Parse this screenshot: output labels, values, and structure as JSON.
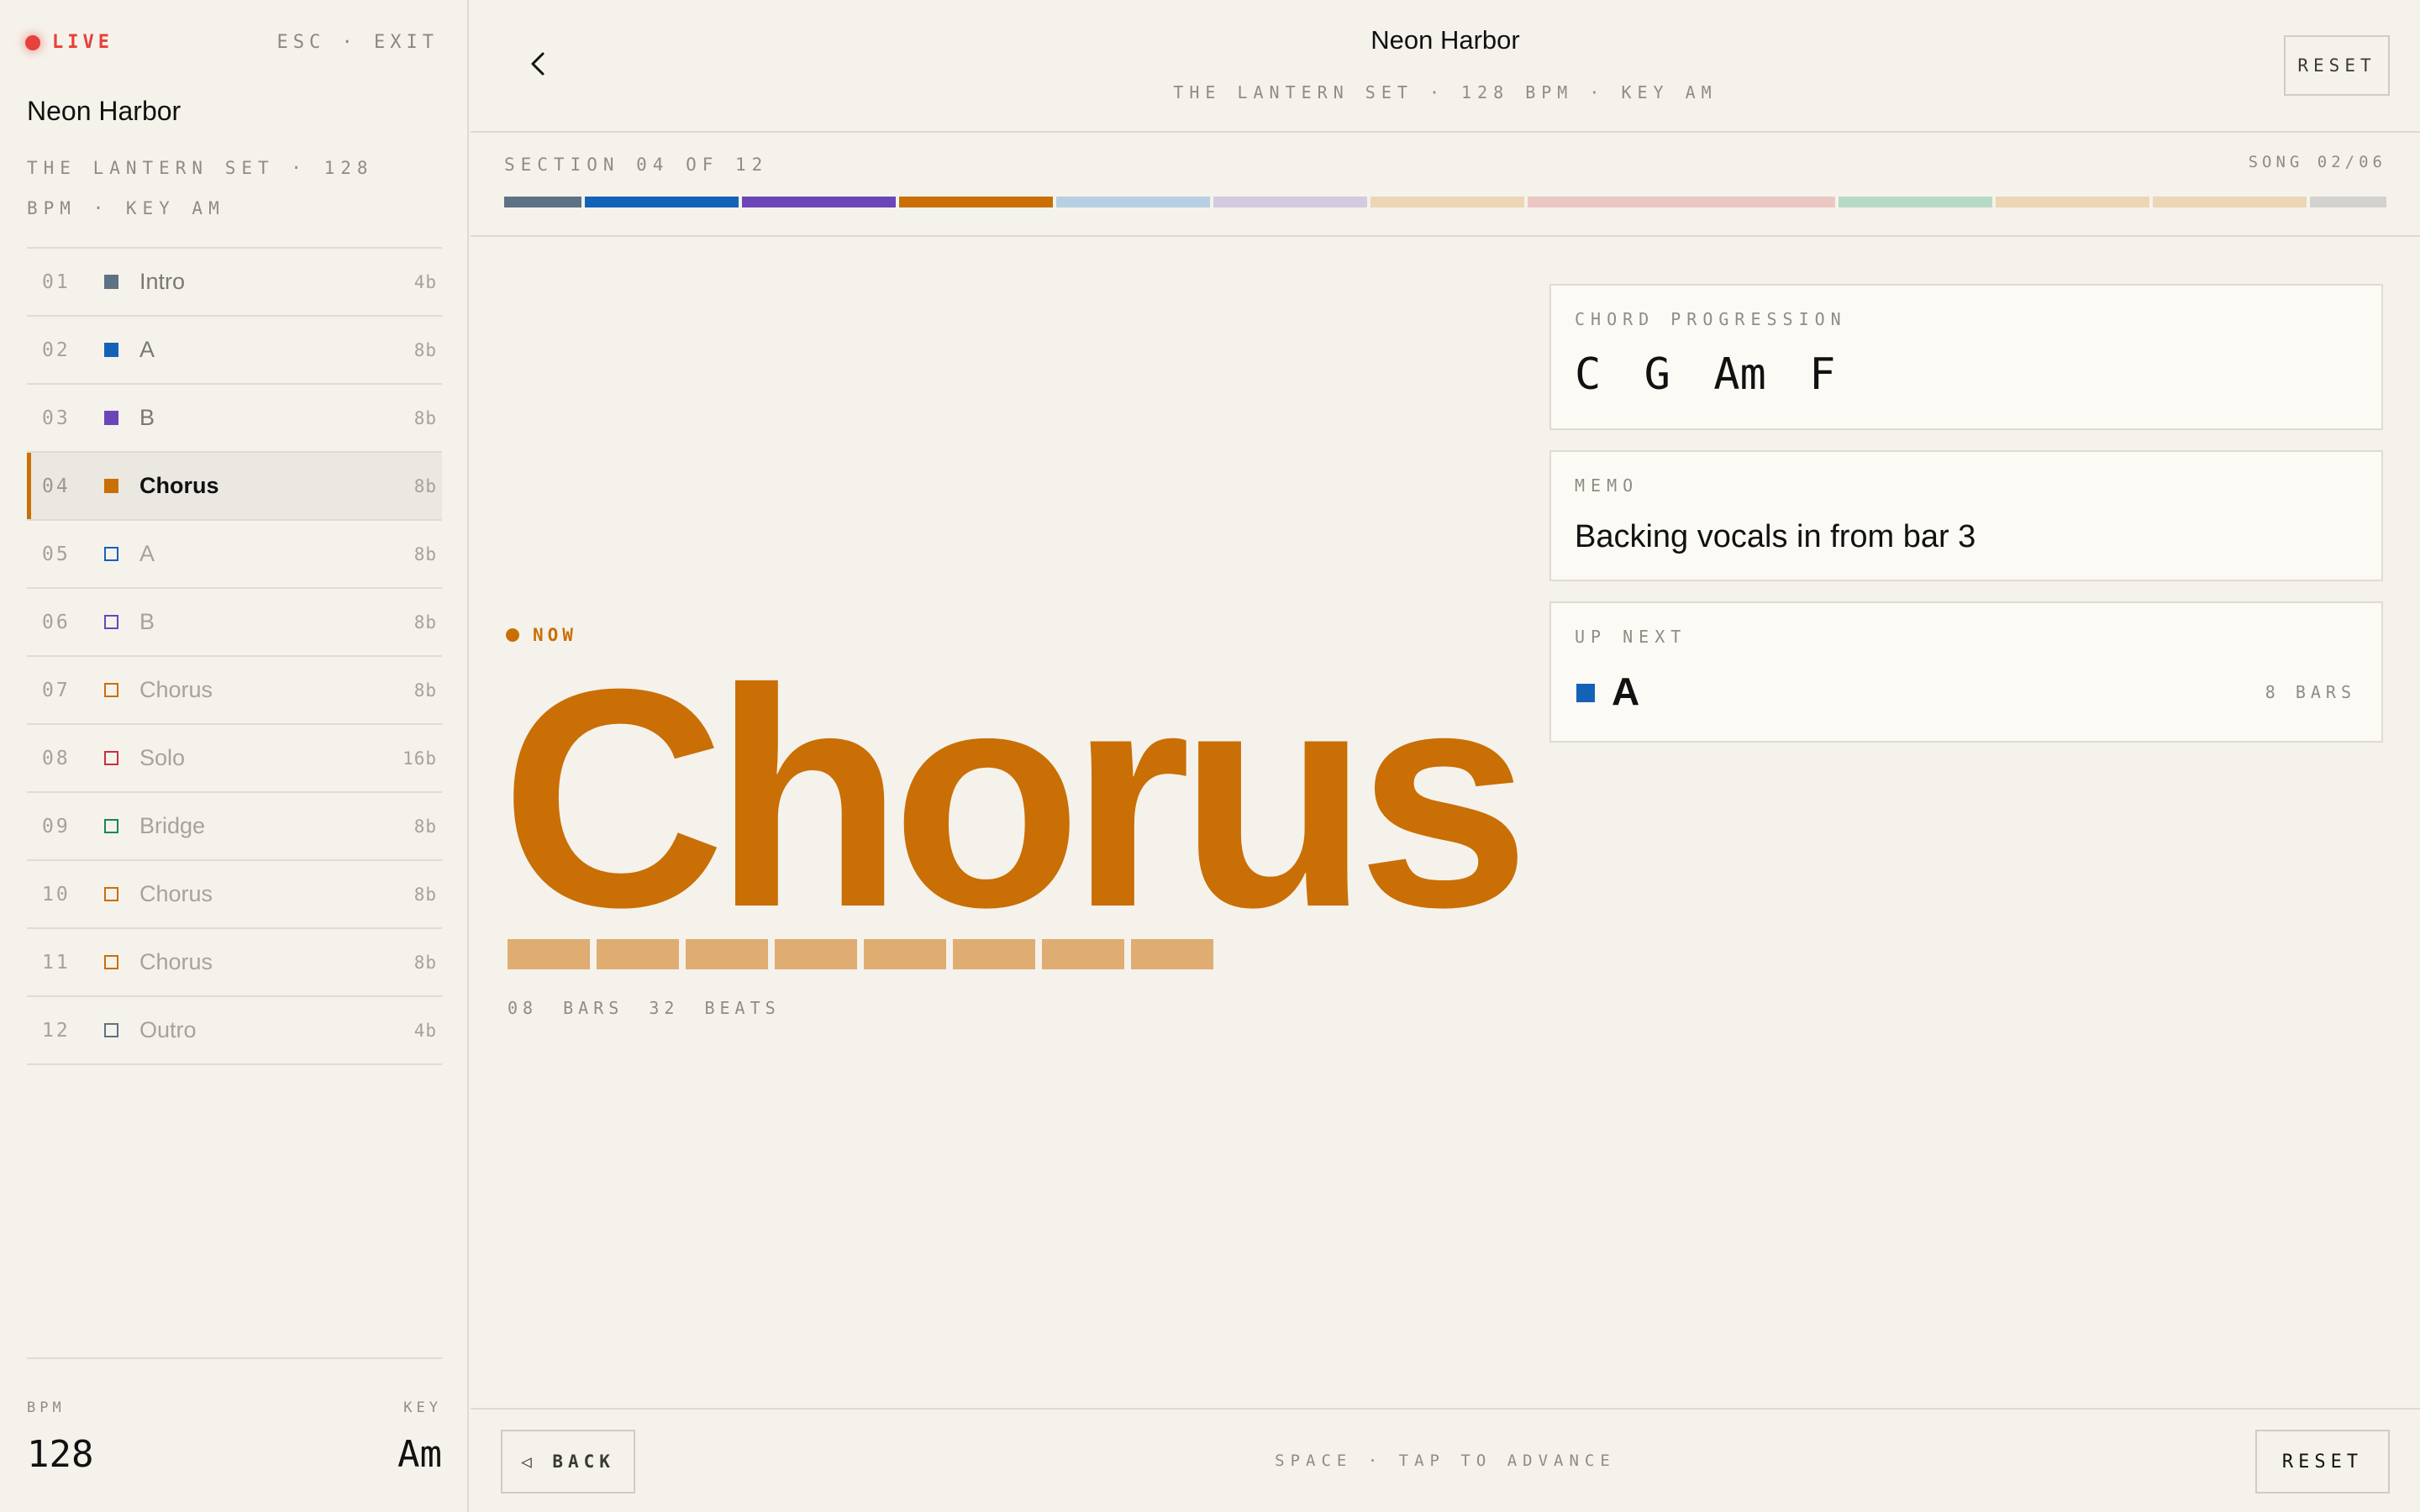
{
  "sidebar": {
    "live_label": "LIVE",
    "exit_label": "ESC · EXIT",
    "song_title": "Neon Harbor",
    "song_meta": "THE LANTERN SET · 128 BPM · KEY AM",
    "sections": [
      {
        "num": "01",
        "name": "Intro",
        "bars": "4b",
        "color": "#5e7185",
        "state": "played"
      },
      {
        "num": "02",
        "name": "A",
        "bars": "8b",
        "color": "#1462b8",
        "state": "played"
      },
      {
        "num": "03",
        "name": "B",
        "bars": "8b",
        "color": "#6b46b8",
        "state": "played"
      },
      {
        "num": "04",
        "name": "Chorus",
        "bars": "8b",
        "color": "#c96f06",
        "state": "active"
      },
      {
        "num": "05",
        "name": "A",
        "bars": "8b",
        "color": "#1462b8",
        "state": "upcoming"
      },
      {
        "num": "06",
        "name": "B",
        "bars": "8b",
        "color": "#6b46b8",
        "state": "upcoming"
      },
      {
        "num": "07",
        "name": "Chorus",
        "bars": "8b",
        "color": "#c96f06",
        "state": "upcoming"
      },
      {
        "num": "08",
        "name": "Solo",
        "bars": "16b",
        "color": "#c8313c",
        "state": "upcoming"
      },
      {
        "num": "09",
        "name": "Bridge",
        "bars": "8b",
        "color": "#14875a",
        "state": "upcoming"
      },
      {
        "num": "10",
        "name": "Chorus",
        "bars": "8b",
        "color": "#c96f06",
        "state": "upcoming"
      },
      {
        "num": "11",
        "name": "Chorus",
        "bars": "8b",
        "color": "#c96f06",
        "state": "upcoming"
      },
      {
        "num": "12",
        "name": "Outro",
        "bars": "4b",
        "color": "#5e7185",
        "state": "upcoming"
      }
    ],
    "bpm_label": "BPM",
    "bpm_value": "128",
    "key_label": "KEY",
    "key_value": "Am"
  },
  "header": {
    "title": "Neon Harbor",
    "meta": "THE LANTERN SET · 128 BPM · KEY AM",
    "reset_label": "RESET"
  },
  "progress": {
    "section_label": "SECTION 04 OF 12",
    "song_label": "SONG 02/06",
    "segments": [
      {
        "color": "#5e7185",
        "weight": 4
      },
      {
        "color": "#1462b8",
        "weight": 8
      },
      {
        "color": "#6b46b8",
        "weight": 8
      },
      {
        "color": "#c96f06",
        "weight": 8
      },
      {
        "color": "#b7cfe2",
        "weight": 8
      },
      {
        "color": "#d2cadf",
        "weight": 8
      },
      {
        "color": "#ecd6b4",
        "weight": 8
      },
      {
        "color": "#ebc7c3",
        "weight": 16
      },
      {
        "color": "#b7dac6",
        "weight": 8
      },
      {
        "color": "#ecd6b4",
        "weight": 8
      },
      {
        "color": "#ecd6b4",
        "weight": 8
      },
      {
        "color": "#d3d2cf",
        "weight": 4
      }
    ]
  },
  "now": {
    "label": "NOW",
    "section_name": "Chorus",
    "accent": "#c96f06",
    "bar_count": 8,
    "bars_text": "08 BARS",
    "beats_text": "32 BEATS"
  },
  "chord_card": {
    "label": "CHORD PROGRESSION",
    "chords": "C G Am F"
  },
  "memo_card": {
    "label": "MEMO",
    "text": "Backing vocals in from bar 3"
  },
  "next_card": {
    "label": "UP NEXT",
    "name": "A",
    "color": "#1462b8",
    "bars": "8 BARS"
  },
  "footer": {
    "back_label": "◁ BACK",
    "hint": "SPACE · TAP TO ADVANCE",
    "reset_label": "RESET"
  }
}
